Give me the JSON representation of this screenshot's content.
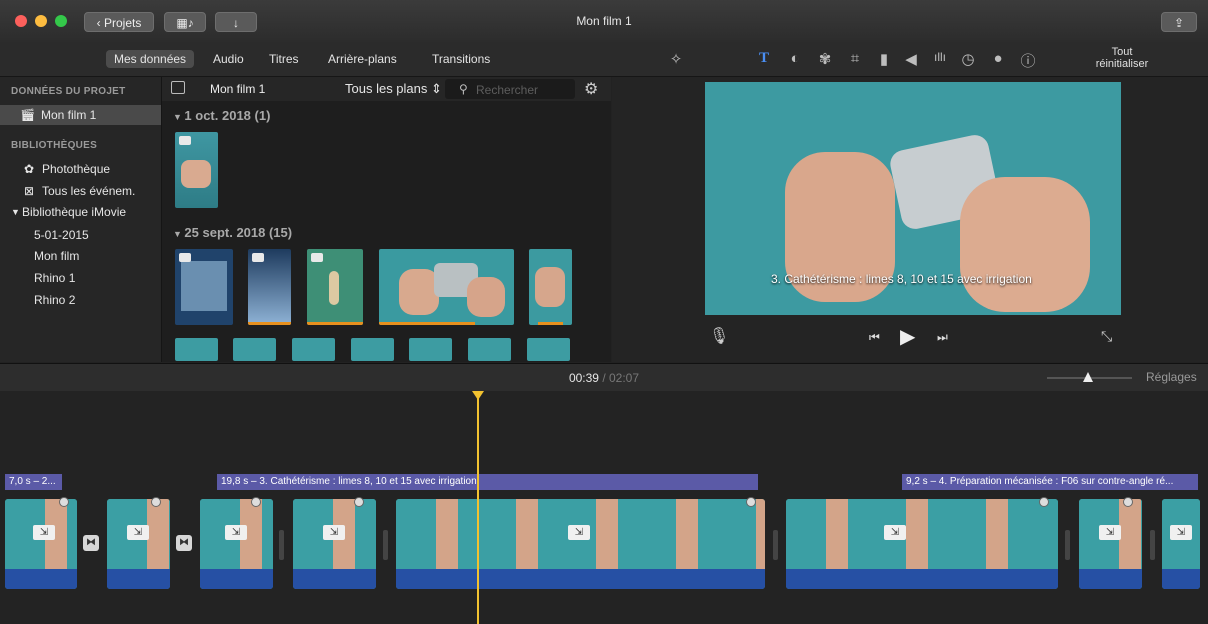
{
  "window": {
    "title": "Mon film 1"
  },
  "toolbar": {
    "projects_label": "Projets",
    "share_icon": "share-icon"
  },
  "tabs": [
    "Mes données",
    "Audio",
    "Titres",
    "Arrière-plans",
    "Transitions"
  ],
  "adjust": {
    "reset_line1": "Tout",
    "reset_line2": "réinitialiser",
    "tool_T": "T"
  },
  "sidebar": {
    "project_header": "DONNÉES DU PROJET",
    "project_item": "Mon film 1",
    "libraries_header": "BIBLIOTHÈQUES",
    "libraries": [
      "Photothèque",
      "Tous les événem.",
      "Bibliothèque iMovie"
    ],
    "events": [
      "5-01-2015",
      "Mon film",
      "Rhino 1",
      "Rhino 2"
    ]
  },
  "browser": {
    "title": "Mon film 1",
    "filter": "Tous les plans",
    "search_placeholder": "Rechercher",
    "group1": "1 oct. 2018  (1)",
    "group2": "25 sept. 2018  (15)"
  },
  "viewer": {
    "subtitle": "3. Cathétérisme : limes 8, 10 et 15 avec irrigation"
  },
  "timeline": {
    "current_time": "00:39",
    "total_time": "02:07",
    "settings_label": "Réglages",
    "title_clips": [
      "7,0 s – 2...",
      "19,8 s – 3. Cathétérisme : limes 8, 10 et 15 avec irrigation",
      "9,2 s – 4. Préparation mécanisée : F06 sur contre-angle ré..."
    ]
  },
  "colors": {
    "accent": "#5b5aa7",
    "clip_blue": "#2650a4",
    "playhead": "#f2c230",
    "video_bg": "#3d9aa1"
  }
}
